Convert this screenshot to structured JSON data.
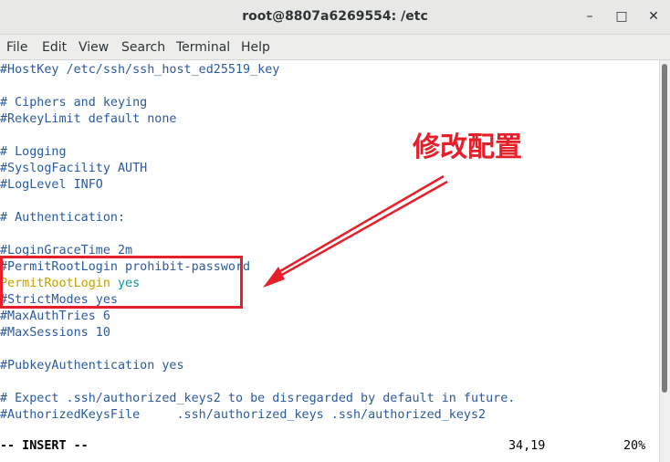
{
  "window": {
    "title": "root@8807a6269554: /etc",
    "minimize_glyph": "–",
    "maximize_glyph": "□",
    "close_glyph": "✕"
  },
  "menu": [
    "File",
    "Edit",
    "View",
    "Search",
    "Terminal",
    "Help"
  ],
  "lines": [
    {
      "text": "#HostKey /etc/ssh/ssh_host_ed25519_key"
    },
    {
      "text": ""
    },
    {
      "text": "# Ciphers and keying"
    },
    {
      "text": "#RekeyLimit default none"
    },
    {
      "text": ""
    },
    {
      "text": "# Logging"
    },
    {
      "text": "#SyslogFacility AUTH"
    },
    {
      "text": "#LogLevel INFO"
    },
    {
      "text": ""
    },
    {
      "text": "# Authentication:"
    },
    {
      "text": ""
    },
    {
      "text": "#LoginGraceTime 2m"
    },
    {
      "text": "#PermitRootLogin prohibit-password"
    },
    {
      "key": "PermitRootLogin",
      "value": "yes"
    },
    {
      "text": "#StrictModes yes"
    },
    {
      "text": "#MaxAuthTries 6"
    },
    {
      "text": "#MaxSessions 10"
    },
    {
      "text": ""
    },
    {
      "text": "#PubkeyAuthentication yes"
    },
    {
      "text": ""
    },
    {
      "text": "# Expect .ssh/authorized_keys2 to be disregarded by default in future."
    },
    {
      "text": "#AuthorizedKeysFile\t.ssh/authorized_keys .ssh/authorized_keys2"
    }
  ],
  "status": {
    "mode": "-- INSERT --",
    "position": "34,19",
    "percent": "20%"
  },
  "annotation": {
    "label": "修改配置",
    "color": "#e6202a"
  },
  "colors": {
    "comment": "#2b5a9e",
    "key": "#c4a000",
    "value": "#06989a"
  }
}
